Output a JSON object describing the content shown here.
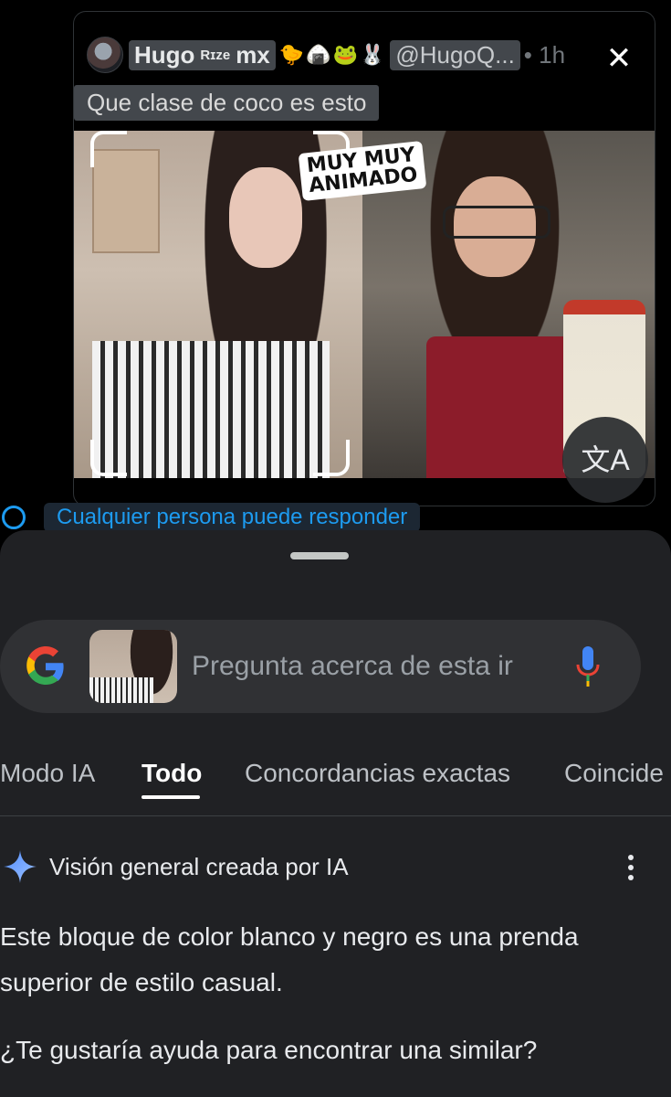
{
  "tweet": {
    "display_name": "Hugo",
    "display_name_sup": "Rɪze",
    "display_name_tail": "mx",
    "emojis": "🐤🍙🐸🐰",
    "handle": "@HugoQ...",
    "time": "• 1h",
    "text": "Que clase de coco es esto",
    "sticker_line1": "MUY MUY",
    "sticker_line2": "ANIMADO",
    "close_icon": "close-icon",
    "translate_icon": "translate-icon"
  },
  "reply": {
    "label": "Cualquier persona puede responder"
  },
  "lens": {
    "search_placeholder": "Pregunta acerca de esta ir",
    "tabs": [
      "Modo IA",
      "Todo",
      "Concordancias exactas",
      "Coincide"
    ],
    "active_tab": "Todo",
    "ai_title": "Visión general creada por IA",
    "ai_paragraph1": "Este bloque de color blanco y negro es una prenda superior de estilo casual.",
    "ai_paragraph2": "¿Te gustaría ayuda para encontrar una similar?"
  },
  "colors": {
    "sheet_bg": "#202124",
    "search_bg": "#303134",
    "link_blue": "#1d9bf0"
  }
}
